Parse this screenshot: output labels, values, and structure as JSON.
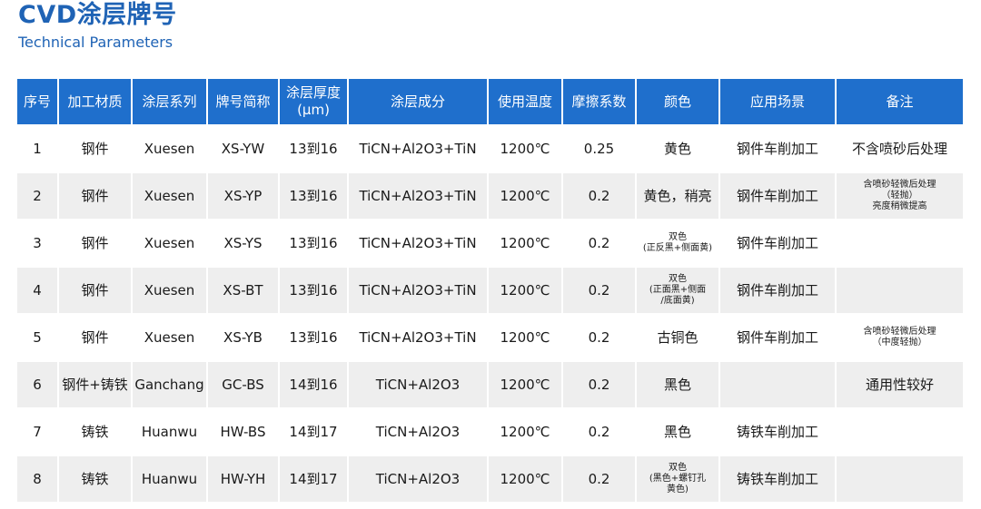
{
  "header": {
    "title": "CVD涂层牌号",
    "subtitle": "Technical Parameters"
  },
  "table": {
    "columns": [
      "序号",
      "加工材质",
      "涂层系列",
      "牌号简称",
      "涂层厚度",
      "(μm)",
      "涂层成分",
      "使用温度",
      "摩擦系数",
      "颜色",
      "应用场景",
      "备注"
    ],
    "rows": [
      {
        "no": "1",
        "material": "钢件",
        "series": "Xuesen",
        "grade": "XS-YW",
        "thickness": "13到16",
        "composition": "TiCN+Al2O3+TiN",
        "temp": "1200℃",
        "friction": "0.25",
        "color": "黄色",
        "color_lines": [],
        "application": "钢件车削加工",
        "note": "不含喷砂后处理",
        "note_lines": []
      },
      {
        "no": "2",
        "material": "钢件",
        "series": "Xuesen",
        "grade": "XS-YP",
        "thickness": "13到16",
        "composition": "TiCN+Al2O3+TiN",
        "temp": "1200℃",
        "friction": "0.2",
        "color": "黄色，稍亮",
        "color_lines": [],
        "application": "钢件车削加工",
        "note": "",
        "note_lines": [
          "含喷砂轻微后处理",
          "（轻抛）",
          "亮度稍微提高"
        ]
      },
      {
        "no": "3",
        "material": "钢件",
        "series": "Xuesen",
        "grade": "XS-YS",
        "thickness": "13到16",
        "composition": "TiCN+Al2O3+TiN",
        "temp": "1200℃",
        "friction": "0.2",
        "color": "",
        "color_lines": [
          "双色",
          "(正反黑+侧面黄)"
        ],
        "application": "钢件车削加工",
        "note": "",
        "note_lines": []
      },
      {
        "no": "4",
        "material": "钢件",
        "series": "Xuesen",
        "grade": "XS-BT",
        "thickness": "13到16",
        "composition": "TiCN+Al2O3+TiN",
        "temp": "1200℃",
        "friction": "0.2",
        "color": "",
        "color_lines": [
          "双色",
          "(正面黑+侧面",
          "/底面黄)"
        ],
        "application": "钢件车削加工",
        "note": "",
        "note_lines": []
      },
      {
        "no": "5",
        "material": "钢件",
        "series": "Xuesen",
        "grade": "XS-YB",
        "thickness": "13到16",
        "composition": "TiCN+Al2O3+TiN",
        "temp": "1200℃",
        "friction": "0.2",
        "color": "古铜色",
        "color_lines": [],
        "application": "钢件车削加工",
        "note": "",
        "note_lines": [
          "含喷砂轻微后处理",
          "（中度轻抛）"
        ]
      },
      {
        "no": "6",
        "material": "钢件+铸铁",
        "series": "Ganchang",
        "grade": "GC-BS",
        "thickness": "14到16",
        "composition": "TiCN+Al2O3",
        "temp": "1200℃",
        "friction": "0.2",
        "color": "黑色",
        "color_lines": [],
        "application": "",
        "note": "通用性较好",
        "note_lines": []
      },
      {
        "no": "7",
        "material": "铸铁",
        "series": "Huanwu",
        "grade": "HW-BS",
        "thickness": "14到17",
        "composition": "TiCN+Al2O3",
        "temp": "1200℃",
        "friction": "0.2",
        "color": "黑色",
        "color_lines": [],
        "application": "铸铁车削加工",
        "note": "",
        "note_lines": []
      },
      {
        "no": "8",
        "material": "铸铁",
        "series": "Huanwu",
        "grade": "HW-YH",
        "thickness": "14到17",
        "composition": "TiCN+Al2O3",
        "temp": "1200℃",
        "friction": "0.2",
        "color": "",
        "color_lines": [
          "双色",
          "(黑色+螺钉孔",
          "黄色)"
        ],
        "application": "铸铁车削加工",
        "note": "",
        "note_lines": []
      }
    ]
  }
}
